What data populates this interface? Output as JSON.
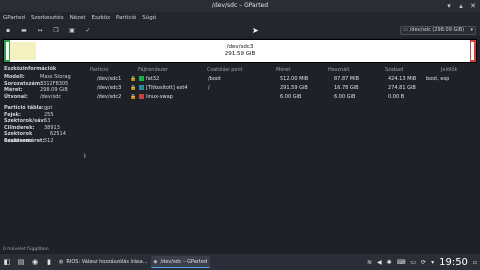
{
  "window": {
    "title": "/dev/sdc – GParted"
  },
  "menu": [
    "GParted",
    "Szerkesztés",
    "Nézet",
    "Eszköz",
    "Partíció",
    "Súgó"
  ],
  "device_selector": {
    "value": "/dev/sdc (298.09 GiB)"
  },
  "diskmap": {
    "name": "/dev/sdc3",
    "size": "291.59 GiB"
  },
  "info": {
    "heading": "Eszközinformációk",
    "model_k": "Modell:",
    "model_v": "Mass Storag",
    "serial_k": "Sorozatszám:",
    "serial_v": "3312F8305",
    "size_k": "Méret:",
    "size_v": "298.09 GiB",
    "path_k": "Útvonal:",
    "path_v": "/dev/sdc",
    "pt_k": "Partíció tábla:",
    "pt_v": "gpt",
    "heads_k": "Fejek:",
    "heads_v": "255",
    "spt_k": "Szektorok/sáv:",
    "spt_v": "63",
    "cyl_k": "Cilinderek:",
    "cyl_v": "38913",
    "tot_k": "Szektorok összesen:",
    "tot_v": "62514",
    "ss_k": "Szektorméret:",
    "ss_v": "512"
  },
  "columns": {
    "partition": "Partíció",
    "fs": "Fájlrendszer",
    "mount": "Csatolási pont",
    "size": "Méret",
    "used": "Használt",
    "free": "Szabad",
    "flags": "Jelölők"
  },
  "rows": [
    {
      "partition": "/dev/sdc1",
      "fs": "fat32",
      "fs_color": "#18b048",
      "mount": "/boot",
      "size": "512.00 MiB",
      "used": "87.87 MiB",
      "free": "424.13 MiB",
      "flags": "boot, esp"
    },
    {
      "partition": "/dev/sdc3",
      "fs": "[Titkosított] ext4",
      "fs_color": "#2a8a9a",
      "mount": "/",
      "size": "291.59 GiB",
      "used": "16.78 GiB",
      "free": "274.81 GiB",
      "flags": ""
    },
    {
      "partition": "/dev/sdc2",
      "fs": "linux-swap",
      "fs_color": "#c84040",
      "mount": "",
      "size": "6.00 GiB",
      "used": "6.00 GiB",
      "free": "0.00 B",
      "flags": ""
    }
  ],
  "status": "0 művelet függőben",
  "taskbar": {
    "task1": "RIOS: Válasz hozzászólás írása...",
    "task2": "/dev/sdc – GParted",
    "clock": "19:50"
  },
  "colors": {
    "accent": "#4fa3ff",
    "used_yellow": "#f4f0c0",
    "boot_green": "#30a050",
    "swap_red": "#d04040"
  }
}
